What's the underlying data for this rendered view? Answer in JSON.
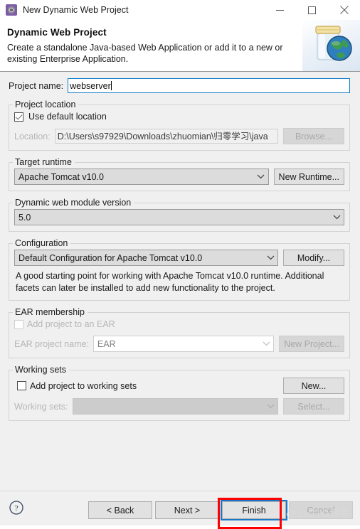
{
  "window": {
    "title": "New Dynamic Web Project",
    "icon": "gear-icon",
    "controls": {
      "minimize": "minimize-icon",
      "maximize": "maximize-icon",
      "close": "close-icon"
    }
  },
  "header": {
    "heading": "Dynamic Web Project",
    "description": "Create a standalone Java-based Web Application or add it to a new or existing Enterprise Application.",
    "art": "java-jar-globe-icon"
  },
  "form": {
    "project_name_label": "Project name:",
    "project_name_value": "webserver",
    "project_name_placeholder": "",
    "project_location": {
      "legend": "Project location",
      "use_default_label": "Use default location",
      "use_default_checked": true,
      "location_label": "Location:",
      "location_value": "D:\\Users\\s97929\\Downloads\\zhuomian\\归零学习\\java",
      "browse_label": "Browse..."
    },
    "target_runtime": {
      "legend": "Target runtime",
      "selected": "Apache Tomcat v10.0",
      "new_runtime_label": "New Runtime..."
    },
    "module_version": {
      "legend": "Dynamic web module version",
      "selected": "5.0"
    },
    "configuration": {
      "legend": "Configuration",
      "selected": "Default Configuration for Apache Tomcat v10.0",
      "modify_label": "Modify...",
      "description": "A good starting point for working with Apache Tomcat v10.0 runtime. Additional facets can later be installed to add new functionality to the project."
    },
    "ear_membership": {
      "legend": "EAR membership",
      "add_to_ear_label": "Add project to an EAR",
      "add_to_ear_checked": false,
      "ear_project_name_label": "EAR project name:",
      "ear_project_name_value": "EAR",
      "new_project_label": "New Project..."
    },
    "working_sets": {
      "legend": "Working sets",
      "add_to_working_sets_label": "Add project to working sets",
      "add_to_working_sets_checked": false,
      "working_sets_label": "Working sets:",
      "working_sets_value": "",
      "new_label": "New...",
      "select_label": "Select..."
    }
  },
  "footer": {
    "help_icon": "help-icon",
    "back_label": "< Back",
    "next_label": "Next >",
    "finish_label": "Finish",
    "cancel_label": "Cancel"
  },
  "annotation": {
    "highlight_target": "Finish",
    "color": "#ff0000"
  },
  "watermark": {
    "text": "@51CTO博客"
  }
}
